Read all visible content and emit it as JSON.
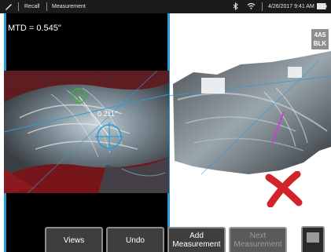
{
  "status_bar": {
    "recall_label": "Recall",
    "screen_title": "Measurement",
    "datetime": "4/26/2017 9:41 AM"
  },
  "measurement": {
    "mtd_readout": "MTD = 0.545\"",
    "dimension_label": "0.211\""
  },
  "view_badge": {
    "line1": "4A5",
    "line2": "BLK"
  },
  "softkeys": {
    "views": "Views",
    "undo": "Undo",
    "add_measurement_line1": "Add",
    "add_measurement_line2": "Measurement",
    "next_measurement_line1": "Next",
    "next_measurement_line2": "Measurement"
  },
  "icons": {
    "edit": "pencil-icon",
    "bluetooth": "bluetooth-icon",
    "wifi": "wifi-icon",
    "battery": "battery-icon",
    "invalid": "red-x-icon"
  },
  "colors": {
    "accent": "#2b9bd6",
    "marker_green": "#3fae3f",
    "invalid_red": "#d2232a",
    "profile_magenta": "#d23cd2"
  }
}
